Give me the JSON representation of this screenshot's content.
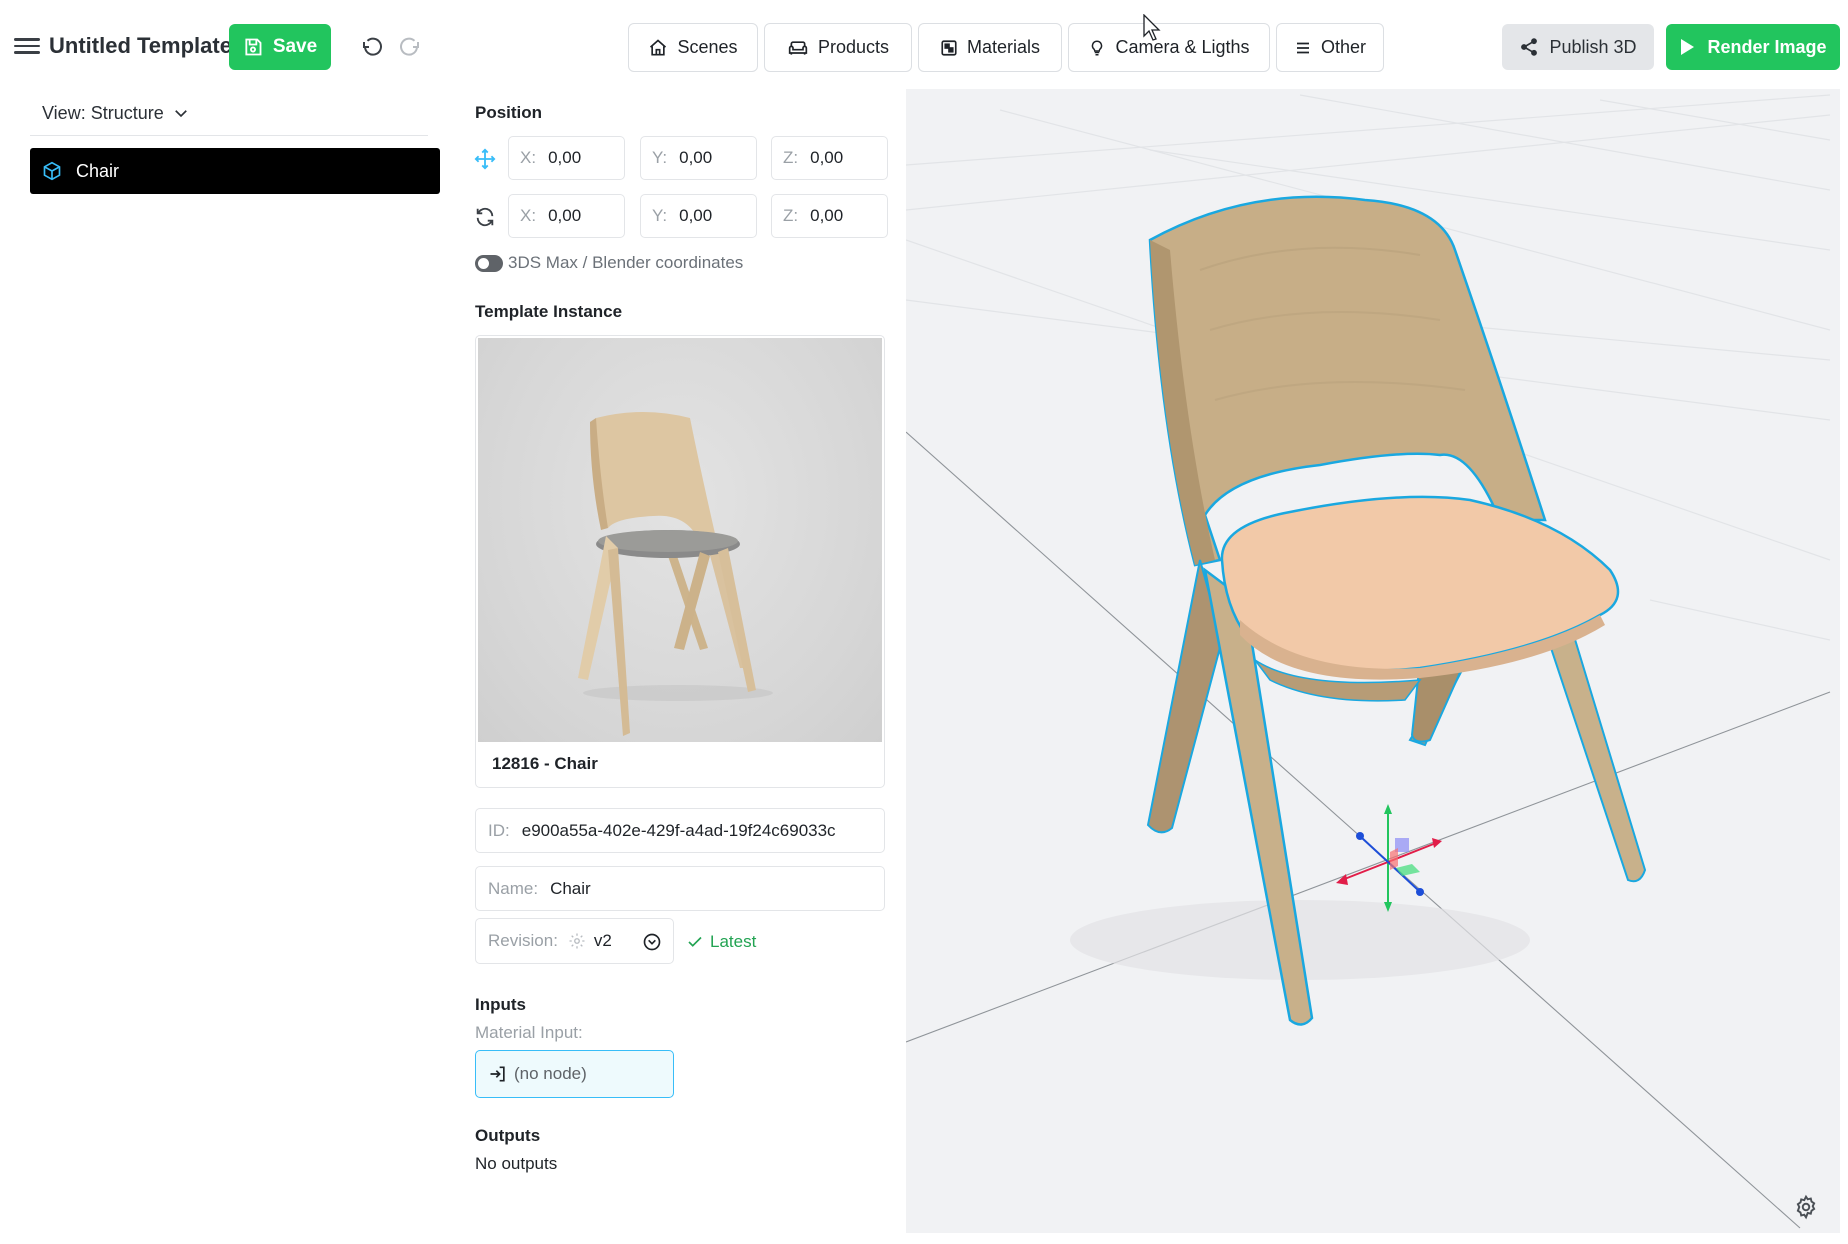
{
  "header": {
    "title": "Untitled Template",
    "save_label": "Save",
    "nav": [
      {
        "label": "Scenes",
        "icon": "home-icon"
      },
      {
        "label": "Products",
        "icon": "sofa-icon"
      },
      {
        "label": "Materials",
        "icon": "material-icon"
      },
      {
        "label": "Camera & Ligths",
        "icon": "lightbulb-icon"
      },
      {
        "label": "Other",
        "icon": "list-icon"
      }
    ],
    "publish_label": "Publish 3D",
    "render_label": "Render Image"
  },
  "left_panel": {
    "view_label": "View: Structure",
    "tree": [
      {
        "label": "Chair",
        "icon": "cube-icon"
      }
    ]
  },
  "properties": {
    "position_title": "Position",
    "position": {
      "x_label": "X:",
      "x": "0,00",
      "y_label": "Y:",
      "y": "0,00",
      "z_label": "Z:",
      "z": "0,00"
    },
    "rotation": {
      "x_label": "X:",
      "x": "0,00",
      "y_label": "Y:",
      "y": "0,00",
      "z_label": "Z:",
      "z": "0,00"
    },
    "coordinates_toggle_label": "3DS Max / Blender coordinates",
    "template_instance_title": "Template Instance",
    "thumbnail_caption": "12816 - Chair",
    "id_label": "ID:",
    "id_value": "e900a55a-402e-429f-a4ad-19f24c69033c",
    "name_label": "Name:",
    "name_value": "Chair",
    "revision_label": "Revision:",
    "revision_value": "v2",
    "latest_label": "Latest",
    "inputs_title": "Inputs",
    "material_input_label": "Material Input:",
    "material_input_value": "(no node)",
    "outputs_title": "Outputs",
    "outputs_empty": "No outputs"
  },
  "colors": {
    "accent_green": "#22c55e",
    "selection_outline": "#1aa8e0",
    "wood": "#c9b08a",
    "seat": "#f2c9a6"
  }
}
